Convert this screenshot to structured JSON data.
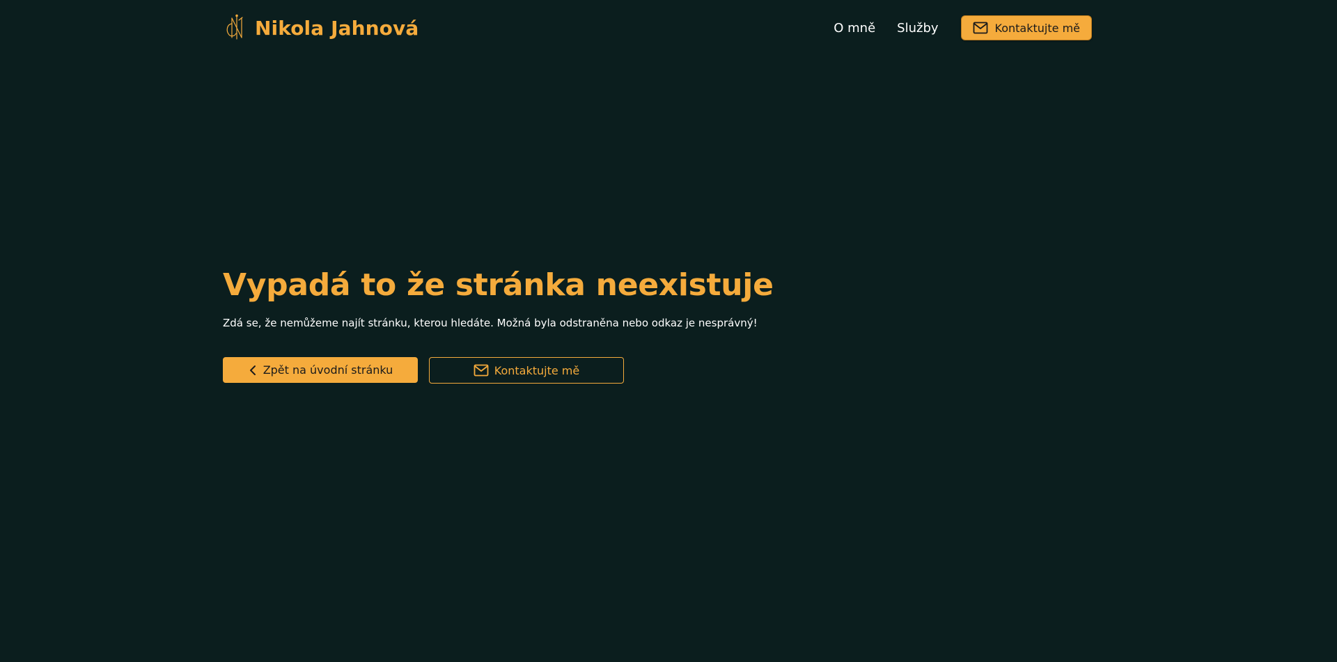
{
  "header": {
    "brand_name": "Nikola Jahnová",
    "nav": {
      "about_label": "O mně",
      "services_label": "Služby",
      "contact_label": "Kontaktujte mě"
    }
  },
  "main": {
    "title": "Vypadá to že stránka neexistuje",
    "subtitle": "Zdá se, že nemůžeme najít stránku, kterou hledáte. Možná byla odstraněna nebo odkaz je nesprávný!",
    "back_button_label": "Zpět na úvodní stránku",
    "contact_button_label": "Kontaktujte mě"
  },
  "icons": {
    "logo": "nj-monogram-icon",
    "mail": "mail-icon",
    "back": "chevron-left-icon"
  },
  "colors": {
    "background": "#0b1e1e",
    "accent": "#f5ab3c",
    "text": "#ffffff",
    "button_text": "#1b1b1b"
  }
}
